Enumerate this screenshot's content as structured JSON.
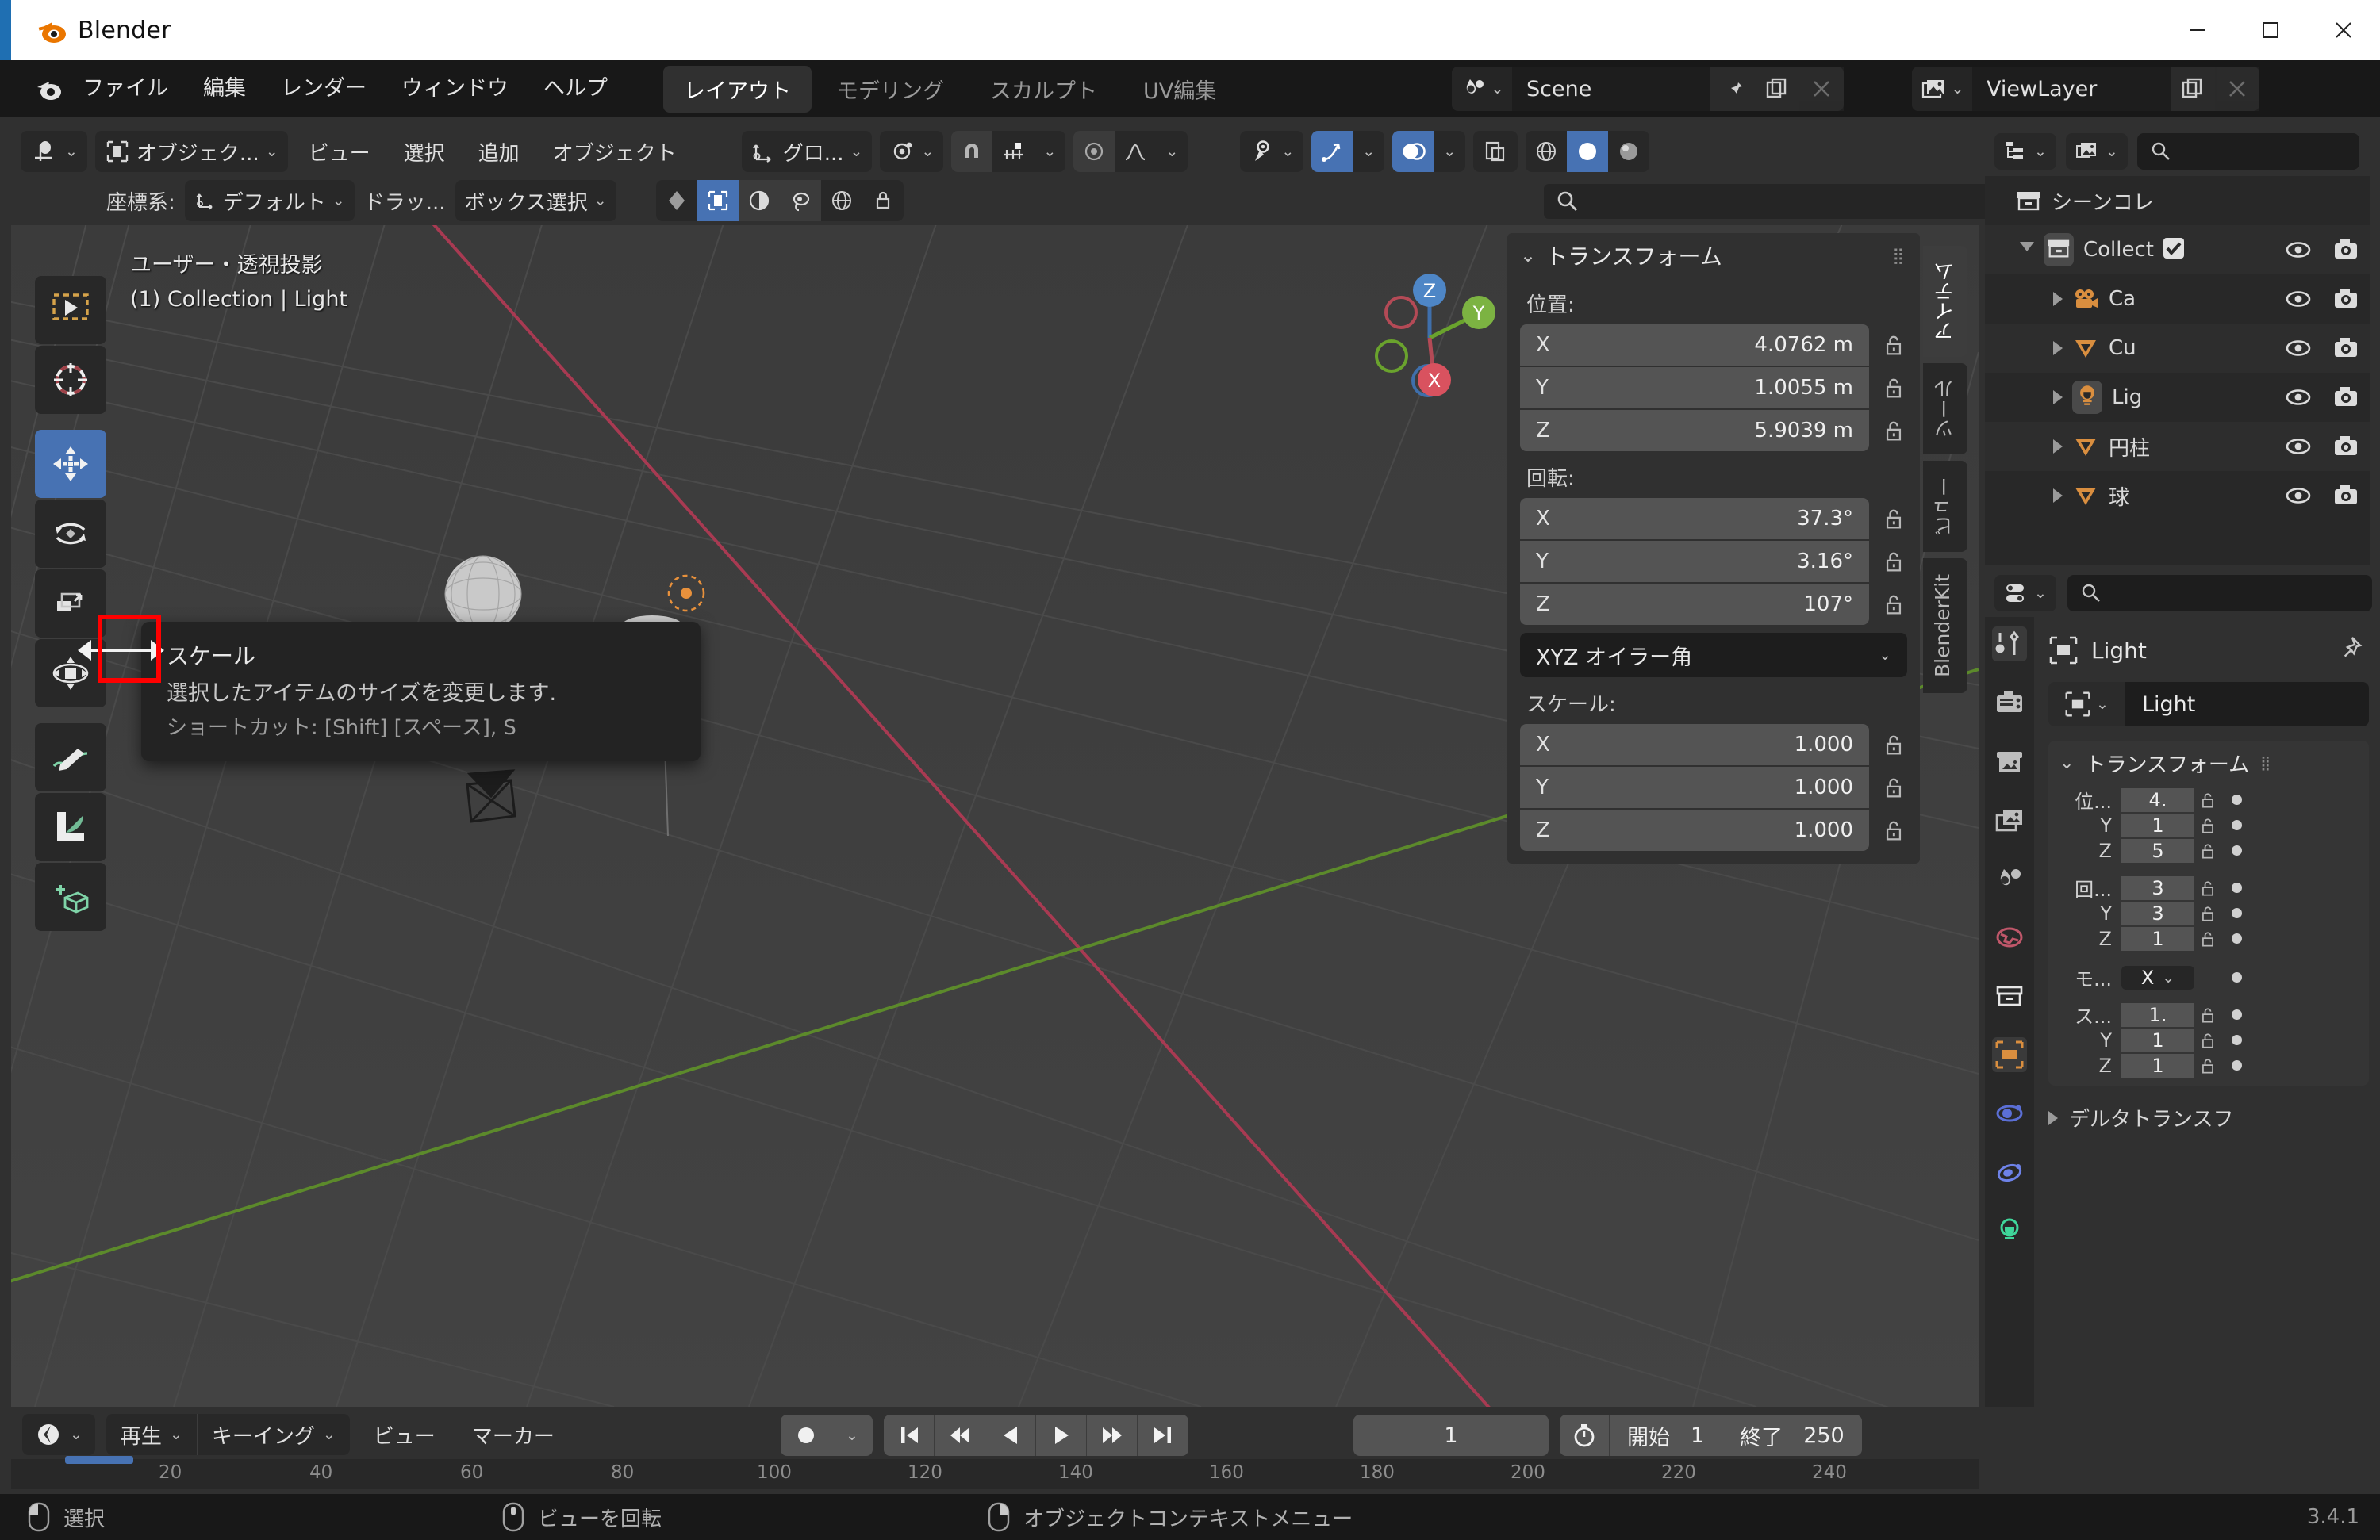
{
  "window": {
    "app_title": "Blender",
    "minimize": "minimize-icon",
    "maximize": "maximize-icon",
    "close": "close-icon"
  },
  "topbar": {
    "menus": [
      "ファイル",
      "編集",
      "レンダー",
      "ウィンドウ",
      "ヘルプ"
    ],
    "workspace_tabs": [
      {
        "label": "レイアウト",
        "active": true
      },
      {
        "label": "モデリング",
        "active": false
      },
      {
        "label": "スカルプト",
        "active": false
      },
      {
        "label": "UV編集",
        "active": false
      }
    ],
    "scene_name": "Scene",
    "viewlayer_name": "ViewLayer"
  },
  "viewport_header": {
    "editor_type": "editor-type-icon",
    "mode": "オブジェク...",
    "menus": [
      "ビュー",
      "選択",
      "追加",
      "オブジェクト"
    ],
    "transform_orientation": "グロ...",
    "snap_label": "snap-magnet-icon",
    "proportional_label": "proportional-editing-icon"
  },
  "tool_settings": {
    "orientation_label": "座標系:",
    "orientation_value": "デフォルト",
    "drag_label": "ドラッ...",
    "drag_value": "ボックス選択"
  },
  "viewport": {
    "view_info_line1": "ユーザー・透視投影",
    "view_info_line2": "(1) Collection | Light",
    "gizmo_axes": [
      "X",
      "Y",
      "Z"
    ]
  },
  "toolbar": {
    "tools": [
      {
        "name": "tweak-tool",
        "active": false
      },
      {
        "name": "cursor-tool",
        "active": false
      },
      {
        "name": "move-tool",
        "active": true
      },
      {
        "name": "rotate-tool",
        "active": false
      },
      {
        "name": "scale-tool",
        "active": false,
        "highlighted": true
      },
      {
        "name": "transform-tool",
        "active": false
      },
      {
        "name": "annotate-tool",
        "active": false
      },
      {
        "name": "measure-tool",
        "active": false
      },
      {
        "name": "add-cube-tool",
        "active": false
      }
    ]
  },
  "tooltip": {
    "title": "スケール",
    "description": "選択したアイテムのサイズを変更します.",
    "shortcut": "ショートカット: [Shift] [スペース], S"
  },
  "n_panel": {
    "panel_title": "トランスフォーム",
    "location_label": "位置:",
    "location": [
      {
        "axis": "X",
        "value": "4.0762 m"
      },
      {
        "axis": "Y",
        "value": "1.0055 m"
      },
      {
        "axis": "Z",
        "value": "5.9039 m"
      }
    ],
    "rotation_label": "回転:",
    "rotation": [
      {
        "axis": "X",
        "value": "37.3°"
      },
      {
        "axis": "Y",
        "value": "3.16°"
      },
      {
        "axis": "Z",
        "value": "107°"
      }
    ],
    "rotation_mode": "XYZ オイラー角",
    "scale_label": "スケール:",
    "scale": [
      {
        "axis": "X",
        "value": "1.000"
      },
      {
        "axis": "Y",
        "value": "1.000"
      },
      {
        "axis": "Z",
        "value": "1.000"
      }
    ],
    "side_tabs": [
      {
        "label": "アイテム",
        "active": true
      },
      {
        "label": "ツール",
        "active": false
      },
      {
        "label": "ビュー",
        "active": false
      },
      {
        "label": "BlenderKit",
        "active": false
      }
    ]
  },
  "outliner": {
    "display_mode": "outliner-display-mode-icon",
    "filter": "outliner-filter-icon",
    "search_placeholder": "",
    "rows": [
      {
        "name": "シーンコレ",
        "icon": "scene-collection-icon",
        "indent": 0,
        "expand": "none",
        "selected": false,
        "has_toggles": false
      },
      {
        "name": "Collect",
        "icon": "collection-icon",
        "indent": 1,
        "expand": "down",
        "selected": true,
        "has_toggles": true,
        "checkbox": true
      },
      {
        "name": "Ca",
        "icon": "camera-icon",
        "indent": 2,
        "expand": "right",
        "selected": false,
        "has_toggles": true
      },
      {
        "name": "Cu",
        "icon": "mesh-icon",
        "indent": 2,
        "expand": "right",
        "selected": false,
        "has_toggles": true
      },
      {
        "name": "Lig",
        "icon": "light-icon",
        "indent": 2,
        "expand": "right",
        "selected": true,
        "has_toggles": true
      },
      {
        "name": "円柱",
        "icon": "mesh-icon",
        "indent": 2,
        "expand": "right",
        "selected": false,
        "has_toggles": true
      },
      {
        "name": "球",
        "icon": "mesh-icon",
        "indent": 2,
        "expand": "right",
        "selected": false,
        "has_toggles": true
      }
    ]
  },
  "properties": {
    "editor_mode": "properties-editor-icon",
    "search_placeholder": "",
    "tabs": [
      {
        "name": "tool-tab",
        "active": true
      },
      {
        "name": "render-tab",
        "active": false
      },
      {
        "name": "output-tab",
        "active": false
      },
      {
        "name": "view-layer-tab",
        "active": false
      },
      {
        "name": "scene-tab",
        "active": false
      },
      {
        "name": "world-tab",
        "active": false
      },
      {
        "name": "collection-tab",
        "active": false
      },
      {
        "name": "object-tab",
        "active": true
      },
      {
        "name": "modifiers-tab",
        "active": false
      },
      {
        "name": "physics-tab",
        "active": false
      },
      {
        "name": "object-data-tab",
        "active": false
      }
    ],
    "breadcrumb": "Light",
    "object_name": "Light",
    "panel_title": "トランスフォーム",
    "rows": [
      {
        "label": "位...",
        "value": "4."
      },
      {
        "label": "Y",
        "value": "1"
      },
      {
        "label": "Z",
        "value": "5"
      }
    ],
    "rot_rows": [
      {
        "label": "回...",
        "value": "3"
      },
      {
        "label": "Y",
        "value": "3"
      },
      {
        "label": "Z",
        "value": "1"
      }
    ],
    "mode_label": "モ...",
    "mode_value": "X",
    "scale_rows": [
      {
        "label": "ス...",
        "value": "1."
      },
      {
        "label": "Y",
        "value": "1"
      },
      {
        "label": "Z",
        "value": "1"
      }
    ],
    "delta_label": "デルタトランスフ"
  },
  "timeline": {
    "editor_icon": "timeline-editor-icon",
    "playback_label": "再生",
    "keying_label": "キーイング",
    "menus": [
      "ビュー",
      "マーカー"
    ],
    "record_icon": "auto-keying-icon",
    "transport": [
      "jump-to-start-icon",
      "prev-keyframe-icon",
      "play-reverse-icon",
      "play-icon",
      "next-keyframe-icon",
      "jump-to-end-icon"
    ],
    "current_frame": "1",
    "start_label": "開始",
    "start_value": "1",
    "end_label": "終了",
    "end_value": "250",
    "ruler_ticks": [
      "20",
      "40",
      "60",
      "80",
      "100",
      "120",
      "140",
      "160",
      "180",
      "200",
      "220",
      "240"
    ]
  },
  "statusbar": {
    "items": [
      {
        "icon": "mouse-left-icon",
        "label": "選択"
      },
      {
        "icon": "mouse-middle-icon",
        "label": "ビューを回転"
      },
      {
        "icon": "mouse-right-icon",
        "label": "オブジェクトコンテキストメニュー"
      }
    ],
    "version": "3.4.1"
  },
  "colors": {
    "accent_blue": "#4772b3",
    "orange": "#e8913c",
    "red_axis": "#b5395b",
    "green_axis": "#5a9e2f",
    "highlight_red": "#ff0000",
    "panel_bg": "#303030",
    "editor_bg": "#282828"
  }
}
